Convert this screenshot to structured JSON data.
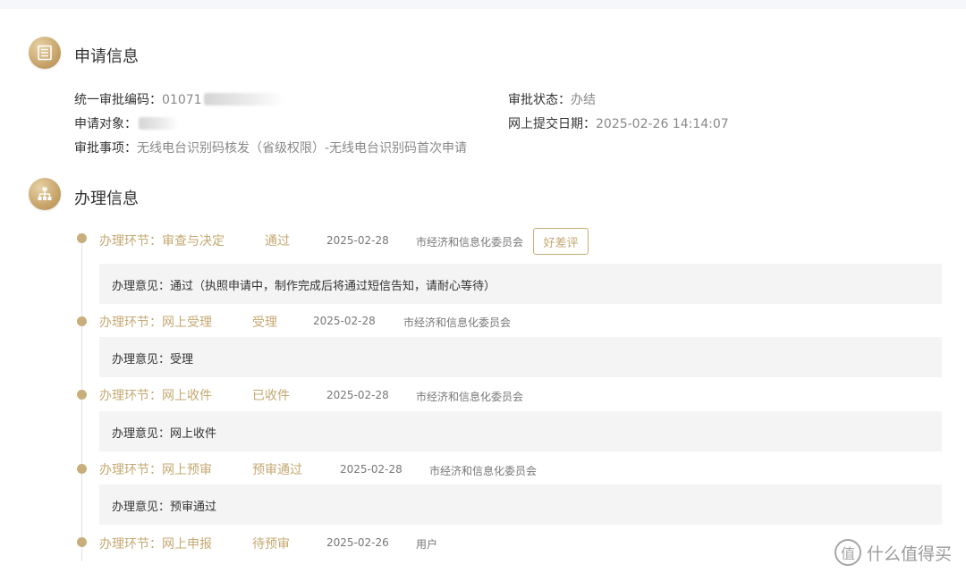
{
  "application_info": {
    "title": "申请信息",
    "approval_code_label": "统一审批编码：",
    "approval_code_value": "01071",
    "applicant_label": "申请对象：",
    "matter_label": "审批事项：",
    "matter_value": "无线电台识别码核发（省级权限）-无线电台识别码首次申请",
    "status_label": "审批状态：",
    "status_value": "办结",
    "submit_date_label": "网上提交日期：",
    "submit_date_value": "2025-02-26 14:14:07"
  },
  "process_info": {
    "title": "办理信息",
    "rate_button": "好差评",
    "steps": [
      {
        "step": "办理环节：审查与决定",
        "result": "通过",
        "date": "2025-02-28",
        "dept": "市经济和信息化委员会",
        "opinion": "办理意见：通过（执照申请中，制作完成后将通过短信告知，请耐心等待）"
      },
      {
        "step": "办理环节：网上受理",
        "result": "受理",
        "date": "2025-02-28",
        "dept": "市经济和信息化委员会",
        "opinion": "办理意见：受理"
      },
      {
        "step": "办理环节：网上收件",
        "result": "已收件",
        "date": "2025-02-28",
        "dept": "市经济和信息化委员会",
        "opinion": "办理意见：网上收件"
      },
      {
        "step": "办理环节：网上预审",
        "result": "预审通过",
        "date": "2025-02-28",
        "dept": "市经济和信息化委员会",
        "opinion": "办理意见：预审通过"
      },
      {
        "step": "办理环节：网上申报",
        "result": "待预审",
        "date": "2025-02-26",
        "dept": "用户"
      }
    ]
  },
  "watermark": {
    "icon_char": "值",
    "text": "什么值得买"
  }
}
